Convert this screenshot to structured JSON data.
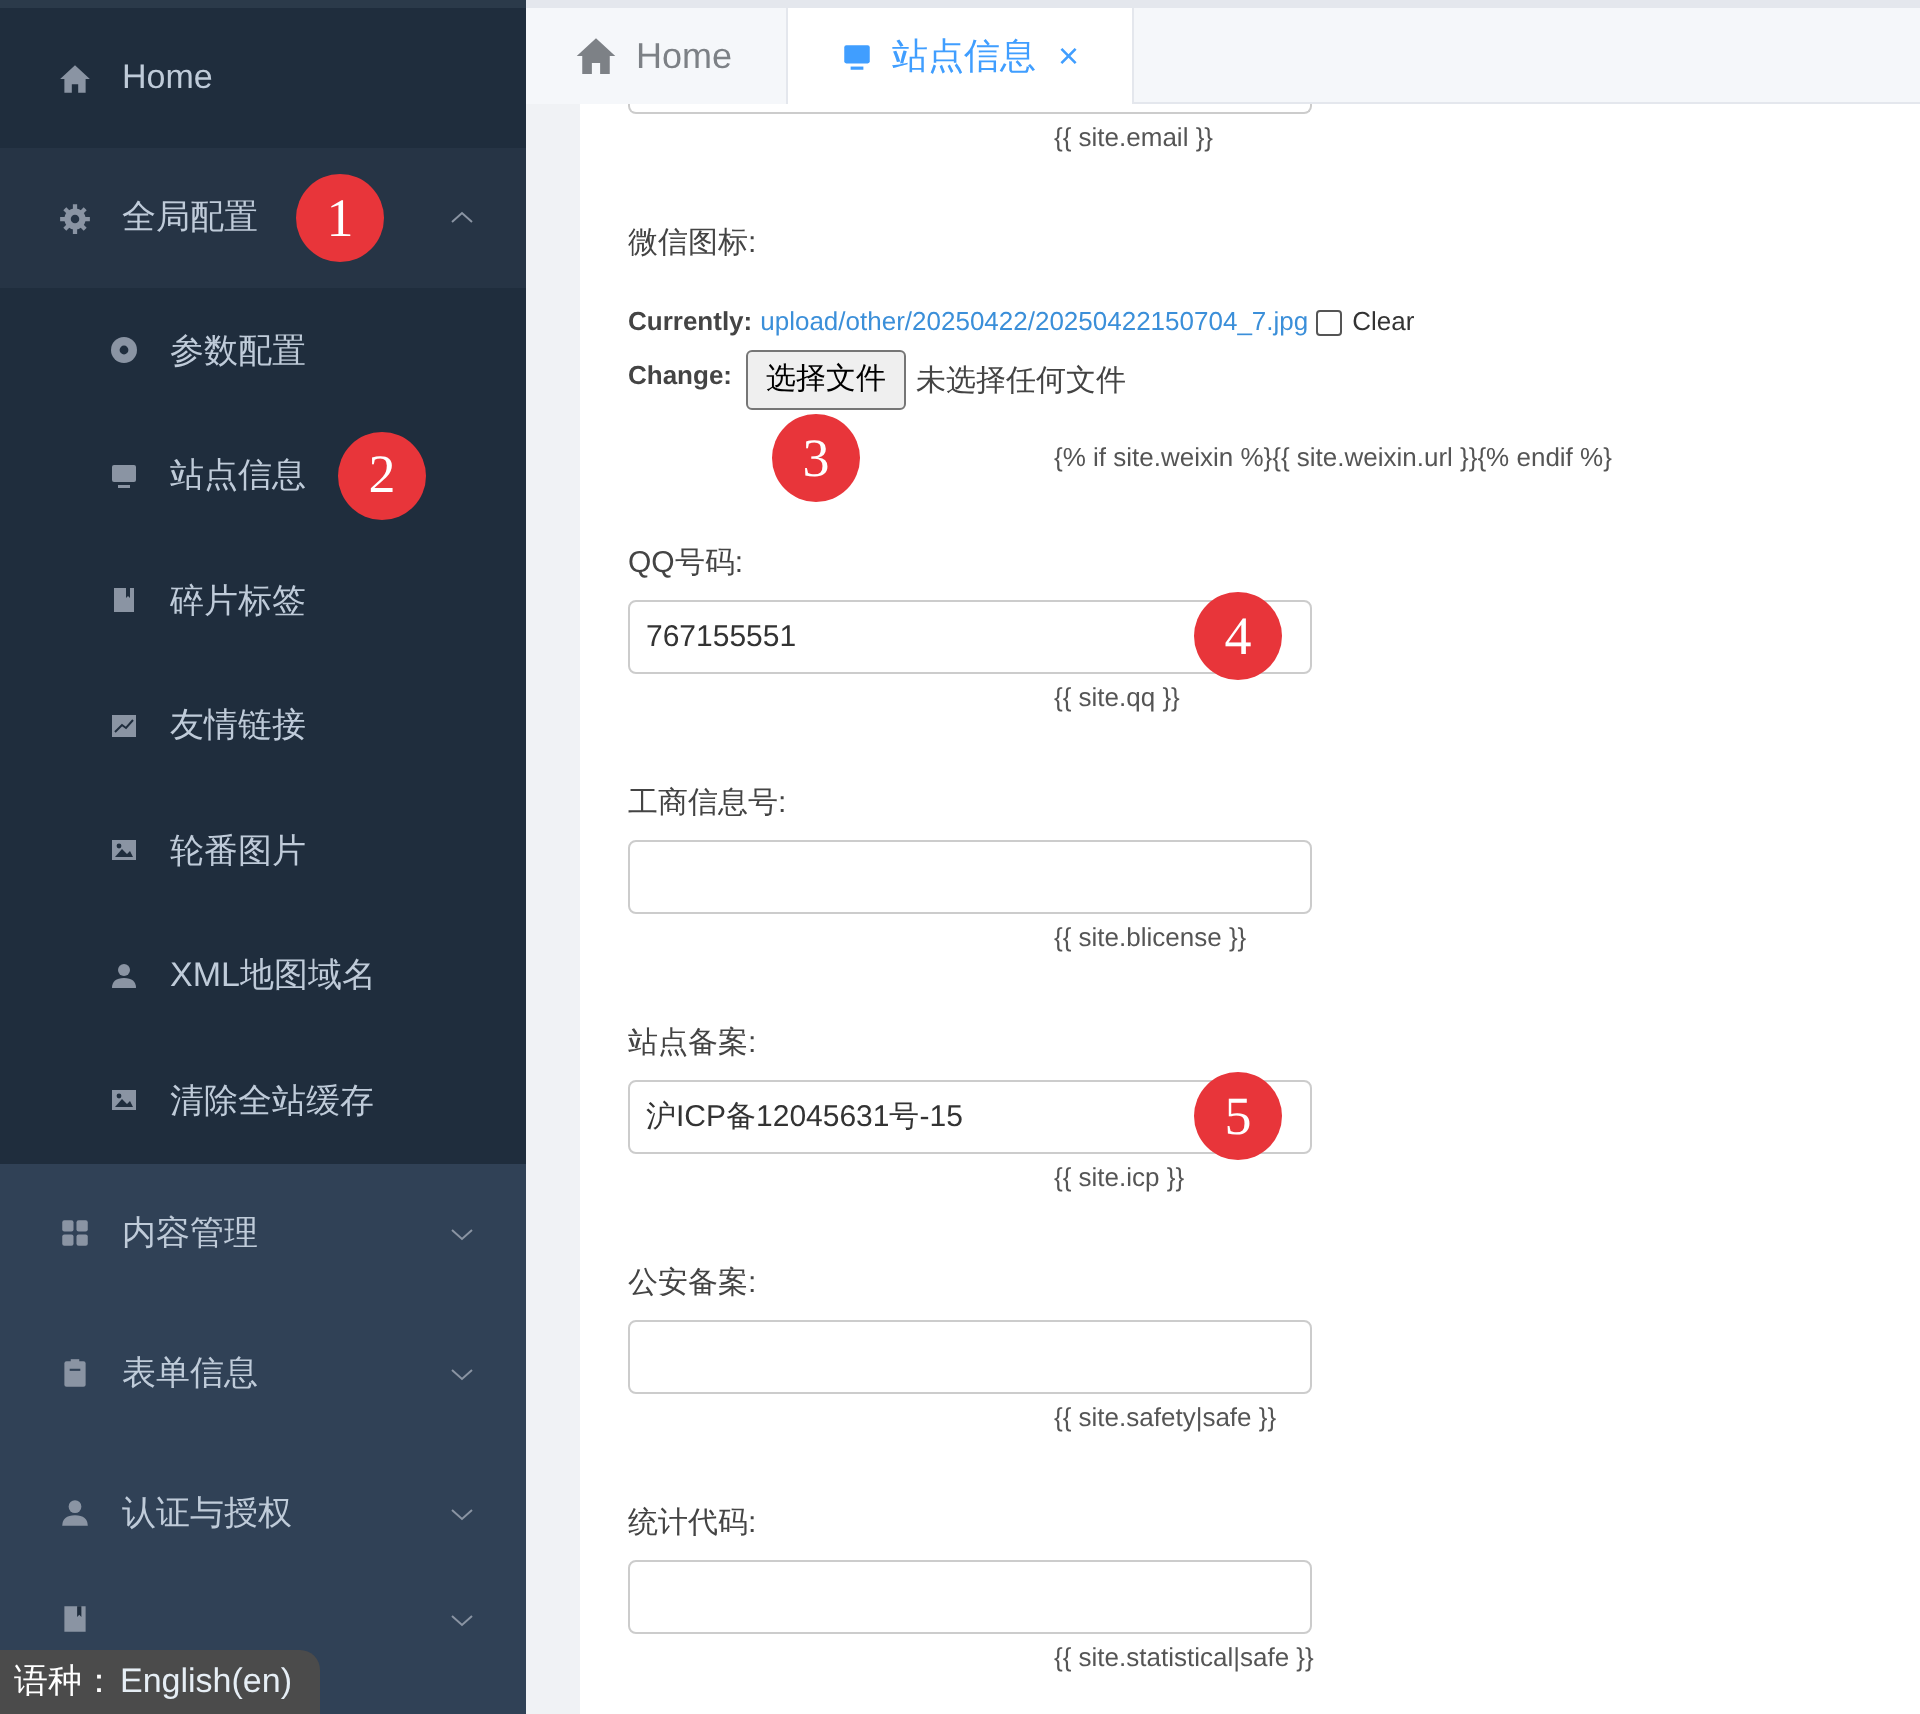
{
  "sidebar": {
    "items": [
      {
        "kind": "link",
        "label": "Home"
      },
      {
        "kind": "group",
        "label": "全局配置",
        "expanded": true,
        "marker": "1",
        "children": [
          {
            "label": "参数配置"
          },
          {
            "label": "站点信息",
            "marker": "2"
          },
          {
            "label": "碎片标签"
          },
          {
            "label": "友情链接"
          },
          {
            "label": "轮番图片"
          },
          {
            "label": "XML地图域名"
          },
          {
            "label": "清除全站缓存"
          }
        ]
      },
      {
        "kind": "group",
        "label": "内容管理",
        "expanded": false
      },
      {
        "kind": "group",
        "label": "表单信息",
        "expanded": false
      },
      {
        "kind": "group",
        "label": "认证与授权",
        "expanded": false
      },
      {
        "kind": "group",
        "expanded": false
      }
    ]
  },
  "language": {
    "label": "语种：",
    "value": "English(en)"
  },
  "tabs": [
    {
      "label": "Home",
      "selected": false
    },
    {
      "label": "站点信息",
      "selected": true,
      "close": "×"
    }
  ],
  "form": {
    "fields": [
      {
        "kind": "cut",
        "help": "{{ site.email }}"
      },
      {
        "kind": "file",
        "label": "微信图标:",
        "currently_label": "Currently:",
        "current_file": "upload/other/20250422/20250422150704_7.jpg",
        "clear_label": "Clear",
        "clear_checked": false,
        "change_label": "Change:",
        "button": "选择文件",
        "no_file": "未选择任何文件",
        "help": "{% if site.weixin %}{{ site.weixin.url }}{% endif %}",
        "marker": "3"
      },
      {
        "kind": "text",
        "label": "QQ号码:",
        "value": "767155551",
        "help": "{{ site.qq }}",
        "marker": "4"
      },
      {
        "kind": "text",
        "label": "工商信息号:",
        "help": "{{ site.blicense }}"
      },
      {
        "kind": "text",
        "label": "站点备案:",
        "value": "沪ICP备12045631号-15",
        "help": "{{ site.icp }}",
        "marker": "5"
      },
      {
        "kind": "text",
        "label": "公安备案:",
        "help": "{{ site.safety|safe }}"
      },
      {
        "kind": "text",
        "label": "统计代码:",
        "help": "{{ site.statistical|safe }}"
      }
    ]
  }
}
